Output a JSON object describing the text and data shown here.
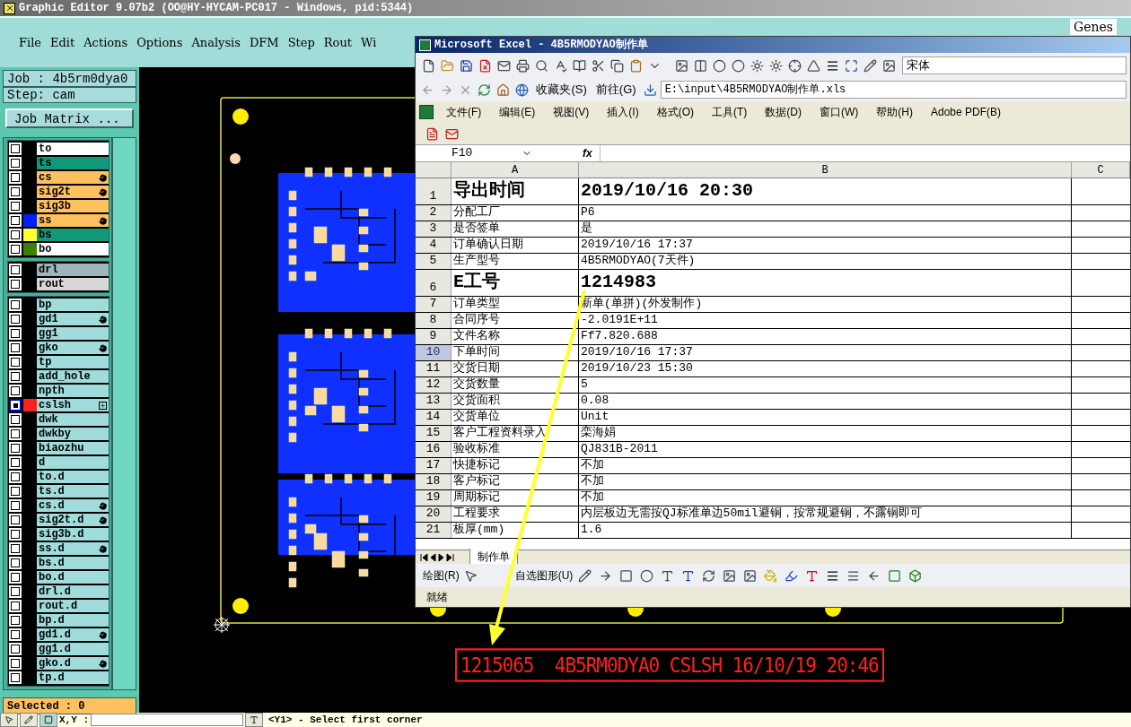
{
  "window": {
    "title": "Graphic Editor 9.07b2 (OO@HY-HYCAM-PC017 - Windows, pid:5344)"
  },
  "menu": [
    "File",
    "Edit",
    "Actions",
    "Options",
    "Analysis",
    "DFM",
    "Step",
    "Rout",
    "Wi"
  ],
  "brand_text": "Genes",
  "job": "Job : 4b5rm0dya0",
  "step": "Step: cam",
  "job_matrix_button": "Job Matrix ...",
  "layer_groups": [
    [
      {
        "name": "to",
        "kind": "outer",
        "hand": false,
        "plus": false,
        "selected": false
      },
      {
        "name": "ts",
        "kind": "mask",
        "hand": false,
        "plus": false,
        "selected": false
      },
      {
        "name": "cs",
        "kind": "signal",
        "hand": true,
        "plus": false,
        "selected": false
      },
      {
        "name": "sig2t",
        "kind": "signal",
        "hand": true,
        "plus": false,
        "selected": false
      },
      {
        "name": "sig3b",
        "kind": "signal",
        "hand": false,
        "plus": false,
        "selected": false
      },
      {
        "name": "ss",
        "kind": "signal",
        "color": "#0020ff",
        "hand": true,
        "plus": false,
        "selected": false
      },
      {
        "name": "bs",
        "kind": "mask",
        "color": "#ffff30",
        "hand": false,
        "plus": false,
        "selected": false
      },
      {
        "name": "bo",
        "kind": "outer",
        "color": "#408000",
        "hand": false,
        "plus": false,
        "selected": false
      }
    ],
    [
      {
        "name": "drl",
        "kind": "drill",
        "hand": false,
        "plus": false,
        "selected": false
      },
      {
        "name": "rout",
        "kind": "rout",
        "hand": false,
        "plus": false,
        "selected": false
      }
    ],
    [
      {
        "name": "bp",
        "kind": "misc",
        "hand": false,
        "plus": false,
        "selected": false
      },
      {
        "name": "gd1",
        "kind": "misc",
        "hand": true,
        "plus": false,
        "selected": false
      },
      {
        "name": "gg1",
        "kind": "misc",
        "hand": false,
        "plus": false,
        "selected": false
      },
      {
        "name": "gko",
        "kind": "misc",
        "hand": true,
        "plus": false,
        "selected": false
      },
      {
        "name": "tp",
        "kind": "misc",
        "hand": false,
        "plus": false,
        "selected": false
      },
      {
        "name": "add_hole",
        "kind": "misc",
        "hand": false,
        "plus": false,
        "selected": false
      },
      {
        "name": "npth",
        "kind": "misc",
        "hand": false,
        "plus": false,
        "selected": false
      },
      {
        "name": "cslsh",
        "kind": "misc",
        "color": "#ff2020",
        "hand": false,
        "plus": true,
        "selected": true
      },
      {
        "name": "dwk",
        "kind": "misc",
        "hand": false,
        "plus": false,
        "selected": false
      },
      {
        "name": "dwkby",
        "kind": "misc",
        "hand": false,
        "plus": false,
        "selected": false
      },
      {
        "name": "biaozhu",
        "kind": "misc",
        "hand": false,
        "plus": false,
        "selected": false
      },
      {
        "name": "d",
        "kind": "misc",
        "hand": false,
        "plus": false,
        "selected": false
      },
      {
        "name": "to.d",
        "kind": "misc",
        "hand": false,
        "plus": false,
        "selected": false
      },
      {
        "name": "ts.d",
        "kind": "misc",
        "hand": false,
        "plus": false,
        "selected": false
      },
      {
        "name": "cs.d",
        "kind": "misc",
        "hand": true,
        "plus": false,
        "selected": false
      },
      {
        "name": "sig2t.d",
        "kind": "misc",
        "hand": true,
        "plus": false,
        "selected": false
      },
      {
        "name": "sig3b.d",
        "kind": "misc",
        "hand": false,
        "plus": false,
        "selected": false
      },
      {
        "name": "ss.d",
        "kind": "misc",
        "hand": true,
        "plus": false,
        "selected": false
      },
      {
        "name": "bs.d",
        "kind": "misc",
        "hand": false,
        "plus": false,
        "selected": false
      },
      {
        "name": "bo.d",
        "kind": "misc",
        "hand": false,
        "plus": false,
        "selected": false
      },
      {
        "name": "drl.d",
        "kind": "misc",
        "hand": false,
        "plus": false,
        "selected": false
      },
      {
        "name": "rout.d",
        "kind": "misc",
        "hand": false,
        "plus": false,
        "selected": false
      },
      {
        "name": "bp.d",
        "kind": "misc",
        "hand": false,
        "plus": false,
        "selected": false
      },
      {
        "name": "gd1.d",
        "kind": "misc",
        "hand": true,
        "plus": false,
        "selected": false
      },
      {
        "name": "gg1.d",
        "kind": "misc",
        "hand": false,
        "plus": false,
        "selected": false
      },
      {
        "name": "gko.d",
        "kind": "misc",
        "hand": true,
        "plus": false,
        "selected": false
      },
      {
        "name": "tp.d",
        "kind": "misc",
        "hand": false,
        "plus": false,
        "selected": false
      }
    ]
  ],
  "selected_count": "Selected : 0",
  "canvas": {
    "board_label": "1215065  4B5RM0DYA0 CSLSH 16/10/19 20:46"
  },
  "excel": {
    "title": "Microsoft Excel - 4B5RMODYAO制作单",
    "font_name": "宋体",
    "favorites": "收藏夹(S)",
    "go": "前往(G)",
    "address": "E:\\input\\4B5RMODYAO制作单.xls",
    "menu": [
      "文件(F)",
      "编辑(E)",
      "视图(V)",
      "插入(I)",
      "格式(O)",
      "工具(T)",
      "数据(D)",
      "窗口(W)",
      "帮助(H)",
      "Adobe PDF(B)"
    ],
    "name_box": "F10",
    "fx": "fx",
    "columns": [
      "A",
      "B",
      "C"
    ],
    "rows": [
      {
        "num": "1",
        "a": "导出时间",
        "b": "2019/10/16 20:30",
        "large": true,
        "selected": false
      },
      {
        "num": "2",
        "a": "分配工厂",
        "b": "P6",
        "large": false,
        "selected": false
      },
      {
        "num": "3",
        "a": "是否签单",
        "b": "是",
        "large": false,
        "selected": false
      },
      {
        "num": "4",
        "a": "订单确认日期",
        "b": "2019/10/16 17:37",
        "large": false,
        "selected": false
      },
      {
        "num": "5",
        "a": "生产型号",
        "b": "4B5RMODYAO(7天件)",
        "large": false,
        "selected": false
      },
      {
        "num": "6",
        "a": "E工号",
        "b": "1214983",
        "large": true,
        "selected": false
      },
      {
        "num": "7",
        "a": "订单类型",
        "b": "新单(单拼)(外发制作)",
        "large": false,
        "selected": false
      },
      {
        "num": "8",
        "a": "合同序号",
        "b": "-2.0191E+11",
        "large": false,
        "selected": false
      },
      {
        "num": "9",
        "a": "文件名称",
        "b": "Ff7.820.688",
        "large": false,
        "selected": false
      },
      {
        "num": "10",
        "a": "下单时间",
        "b": "2019/10/16 17:37",
        "large": false,
        "selected": true
      },
      {
        "num": "11",
        "a": "交货日期",
        "b": "2019/10/23 15:30",
        "large": false,
        "selected": false
      },
      {
        "num": "12",
        "a": "交货数量",
        "b": "5",
        "large": false,
        "selected": false
      },
      {
        "num": "13",
        "a": "交货面积",
        "b": "0.08",
        "large": false,
        "selected": false
      },
      {
        "num": "14",
        "a": "交货单位",
        "b": "Unit",
        "large": false,
        "selected": false
      },
      {
        "num": "15",
        "a": "客户工程资料录入",
        "b": "栾海娟",
        "large": false,
        "selected": false
      },
      {
        "num": "16",
        "a": "验收标准",
        "b": "QJ831B-2011",
        "large": false,
        "selected": false
      },
      {
        "num": "17",
        "a": "快捷标记",
        "b": "不加",
        "large": false,
        "selected": false
      },
      {
        "num": "18",
        "a": "客户标记",
        "b": "不加",
        "large": false,
        "selected": false
      },
      {
        "num": "19",
        "a": "周期标记",
        "b": "不加",
        "large": false,
        "selected": false
      },
      {
        "num": "20",
        "a": "工程要求",
        "b": "内层板边无需按QJ标准单边50mil避铜，按常规避铜，不露铜即可",
        "large": false,
        "selected": false
      },
      {
        "num": "21",
        "a": "板厚(mm)",
        "b": "1.6",
        "large": false,
        "selected": false
      }
    ],
    "sheet_tab": "制作单",
    "draw_menu": "绘图(R)",
    "autoshapes": "自选图形(U)",
    "status": "就绪"
  },
  "status_bar": {
    "xy_label": "X,Y :",
    "prompt": "<Y1> - Select first corner"
  }
}
